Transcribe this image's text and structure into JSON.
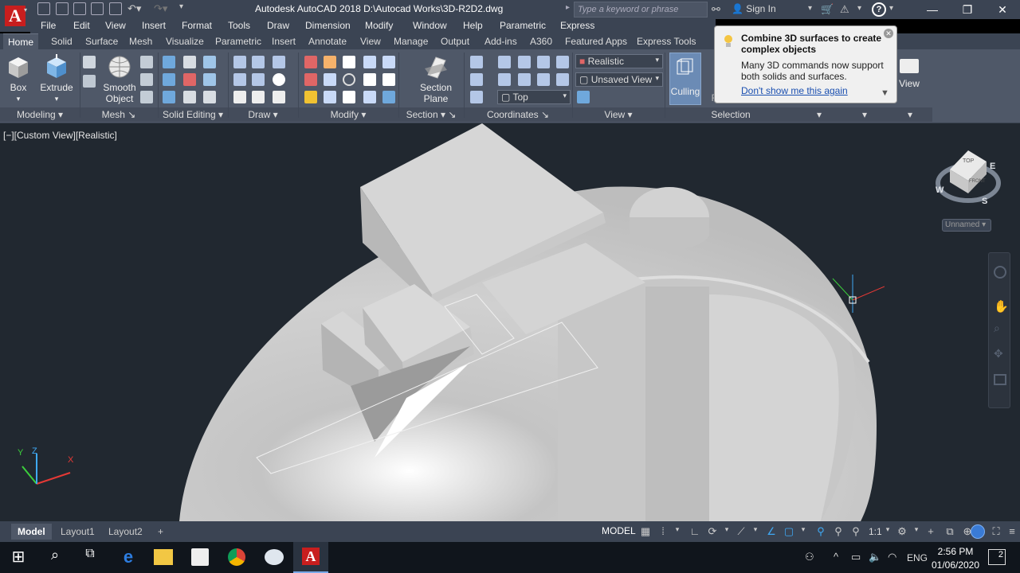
{
  "titlebar": {
    "title": "Autodesk AutoCAD 2018    D:\\Autocad Works\\3D-R2D2.dwg",
    "search_placeholder": "Type a keyword or phrase",
    "signin": "Sign In"
  },
  "menu": [
    "File",
    "Edit",
    "View",
    "Insert",
    "Format",
    "Tools",
    "Draw",
    "Dimension",
    "Modify",
    "Window",
    "Help",
    "Parametric",
    "Express"
  ],
  "ribbon_tabs": [
    "Home",
    "Solid",
    "Surface",
    "Mesh",
    "Visualize",
    "Parametric",
    "Insert",
    "Annotate",
    "View",
    "Manage",
    "Output",
    "Add-ins",
    "A360",
    "Featured Apps",
    "Express Tools"
  ],
  "ribbon": {
    "box": "Box",
    "extrude": "Extrude",
    "smooth_object": "Smooth Object",
    "section_plane": "Section Plane",
    "culling": "Culling",
    "no_filter": "No Filter",
    "view": "View",
    "visual_style": "Realistic",
    "named_view": "Unsaved View",
    "ucs_view": "Top",
    "panels": [
      "Modeling",
      "Mesh",
      "Solid Editing",
      "Draw",
      "Modify",
      "Section",
      "Coordinates",
      "View",
      "Selection"
    ]
  },
  "tooltip": {
    "title": "Combine 3D surfaces to create complex objects",
    "body": "Many 3D commands now support both solids and surfaces.",
    "link": "Don't show me this again"
  },
  "viewport": {
    "label": "[−][Custom View][Realistic]",
    "cube_top": "TOP",
    "cube_front": "FRONT",
    "compass": {
      "n": "",
      "e": "E",
      "s": "S",
      "w": "W"
    },
    "ucs_name": "Unnamed",
    "axis": {
      "x": "X",
      "y": "Y",
      "z": "Z"
    }
  },
  "layout_tabs": [
    "Model",
    "Layout1",
    "Layout2"
  ],
  "status": {
    "model": "MODEL",
    "scale": "1:1"
  },
  "taskbar": {
    "lang": "ENG",
    "time": "2:56 PM",
    "date": "01/06/2020",
    "notif_count": "2"
  },
  "colors": {
    "ui_dark": "#3b4453",
    "ribbon": "#4f5868",
    "viewport": "#212830",
    "model_light": "#d8d8d8",
    "accent_red": "#c81e1e"
  }
}
